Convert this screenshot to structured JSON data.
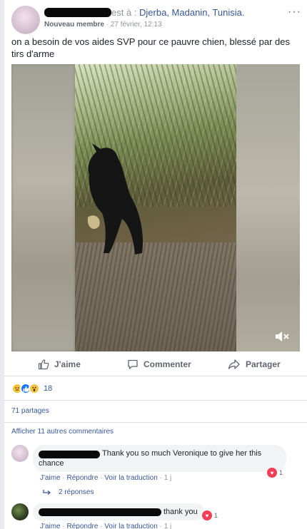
{
  "header": {
    "at_text": "est à : ",
    "location": "Djerba, Madanin, Tunisia.",
    "member_badge": "Nouveau membre",
    "date": " · 27 février, 12:13",
    "more": "···"
  },
  "post": {
    "text": "on a besoin de vos aides SVP pour ce pauvre chien, blessé par des tirs d'arme"
  },
  "actions": {
    "like": "J'aime",
    "comment": "Commenter",
    "share": "Partager"
  },
  "reactions": {
    "count": "18",
    "shares": "71 partages"
  },
  "comments_link": "Afficher 11 autres commentaires",
  "comments": [
    {
      "text": "Thank you so much Veronique to give her this chance",
      "reaction_count": "1",
      "like": "J'aime",
      "reply": "Répondre",
      "translate": "Voir la traduction",
      "time": "1 j",
      "replies": "2 réponses"
    },
    {
      "text": "thank you",
      "reaction_count": "1",
      "like": "J'aime",
      "reply": "Répondre",
      "translate": "Voir la traduction",
      "time": "1 j"
    }
  ],
  "colors": {
    "link": "#385898",
    "meta": "#90949c",
    "heart": "#f33e58",
    "like_blue": "#1877f2"
  }
}
